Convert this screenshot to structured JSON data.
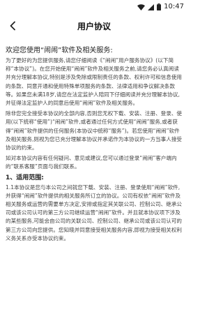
{
  "status_bar": {
    "time": "10:47"
  },
  "app_bar": {
    "title": "用户协议"
  },
  "document": {
    "title": "欢迎您使用“闹闹”软件及相关服务:",
    "paragraphs": [
      "为了更好的为您提供服务,请您仔细阅读《“闹闹”用户服务协议》(以下简称“本协议”)。在您开始使用“闹闹”软件及相关服务之前,请您务必认真阅读并充分理解本协议,特别是涉及免除或限制责任的条款、权利许可和信息使用的条款、同意开通和使用特殊单项服务的条款、法律适用和争议解决条款等。如果您未满18岁,请您在法定监护人陪同下仔细阅读并充分理解本协议,并征得法定监护人的同意后使用“闹闹”软件及相关服务。",
      "除非您完全接受本协议的全部内容,否则您无权下载、安装、注册、登录、使用(以下统称“使用”)“闹闹”软件,或者通过任何方式使用“闹闹”服务,或者获得“闹闹”软件提供的任何服务(本协议中统称“服务”)。若您使用“闹闹”软件及相关服务,则视为您已充分理解本协议并承诺作为本协议的一方当事人接受协议的约束。",
      "如对本协议内容有任何疑问、意见或建议,您可以通过登录“闹闹”客户端内的“联系客服”页面与我们联系。"
    ],
    "section_heading": "1、适用范围:",
    "section_paragraphs": [
      "1.1本协议是您与本公司之间就您下载、安装、注册、登录使用“闹闹”软件,并获得“闹闹”软件提供的相关服务所订立的协议。公司有权依“闹闹”软件及相关服务或运营的需要单方决定,安排或指定其关联公司、控制公司、继承公司或该公司认可的第三方公司继续运营“闹闹”软件。并且就本协议项下涉及的某些服务,可能会由公司的关联公司、控制公司、继承公司或该公司认可的第三方公司向您提供。您知晓并同意接受相关服务内容,即视为接受相关权利义务关系亦受本协议约束。"
    ]
  },
  "colors": {
    "background": "#ffffff",
    "title_text": "#111111",
    "body_text": "#444444"
  }
}
